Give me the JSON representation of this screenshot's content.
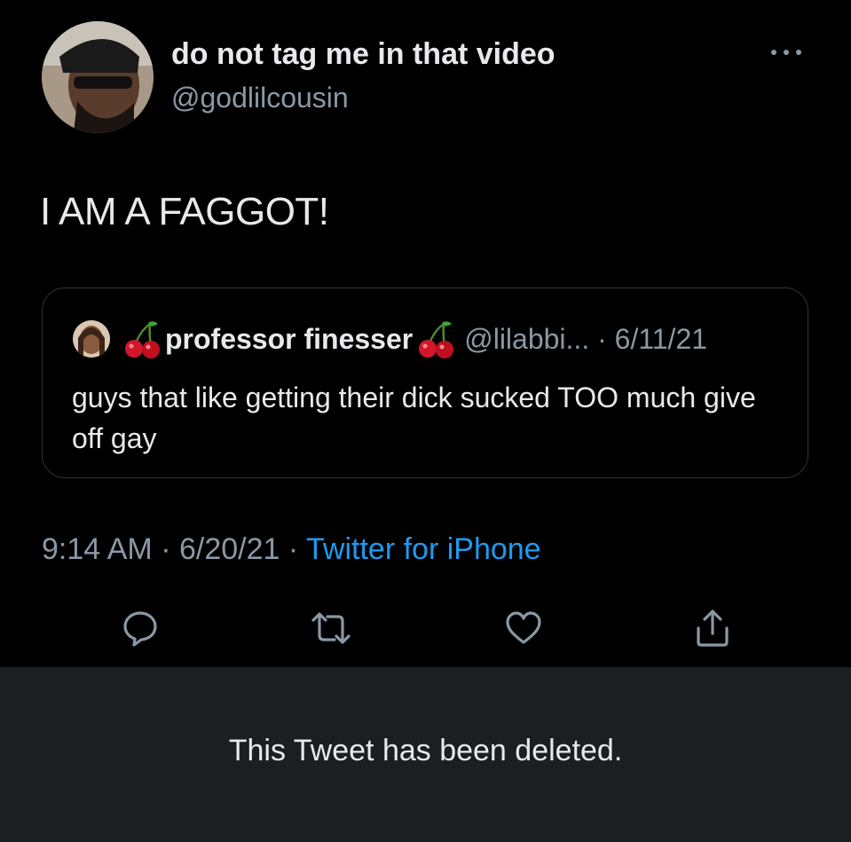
{
  "author": {
    "display_name": "do not tag me in that video",
    "handle": "@godlilcousin"
  },
  "tweet": {
    "text": "I AM A FAGGOT!",
    "time": "9:14 AM",
    "separator1": " · ",
    "date": "6/20/21",
    "separator2": " · ",
    "source": "Twitter for iPhone"
  },
  "quoted_tweet": {
    "display_name": "professor finesser",
    "handle_date": "@lilabbi... · 6/11/21",
    "text": "guys that like getting their dick sucked TOO much give off gay"
  },
  "actions": [
    "reply-icon",
    "retweet-icon",
    "like-icon",
    "share-icon"
  ],
  "deleted_notice": "This Tweet has been deleted.",
  "colors": {
    "background": "#000000",
    "text": "#e7e9ea",
    "secondary": "#8b98a5",
    "link": "#1d9bf0",
    "deleted_bar": "#1c1f22"
  }
}
